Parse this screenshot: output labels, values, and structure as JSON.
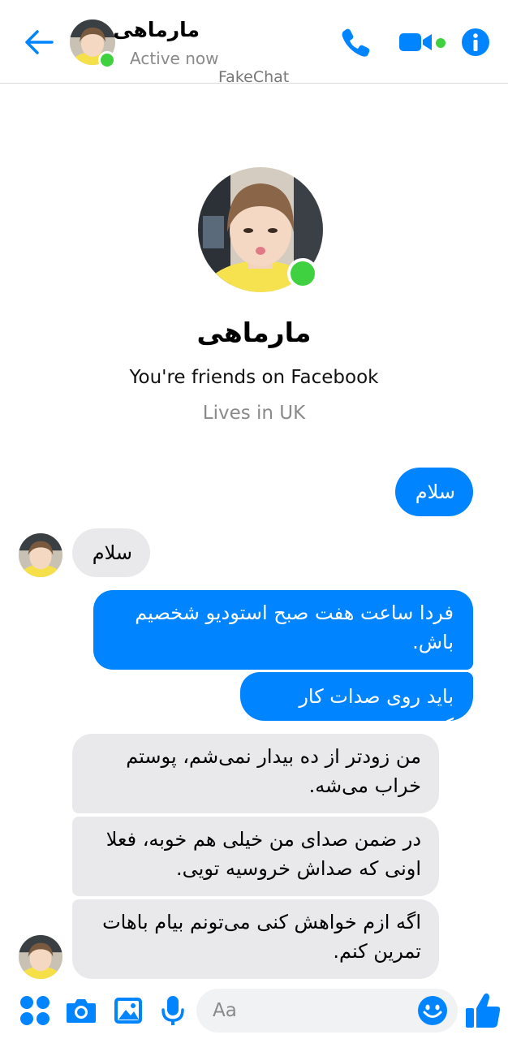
{
  "header": {
    "contact_name": "مارماهی",
    "status": "Active now",
    "watermark": "FakeChat",
    "icons": [
      "back-arrow-icon",
      "phone-icon",
      "video-camera-icon",
      "info-icon"
    ]
  },
  "profile": {
    "name": "مارماهی",
    "relationship": "You're friends on Facebook",
    "location": "Lives in UK"
  },
  "messages": [
    {
      "direction": "outgoing",
      "text": "سلام"
    },
    {
      "direction": "incoming",
      "text": "سلام"
    },
    {
      "direction": "outgoing",
      "text": "فردا ساعت هفت صبح استودیو شخصیم باش."
    },
    {
      "direction": "outgoing",
      "text": "باید روی صدات کار کنم."
    },
    {
      "direction": "incoming",
      "text": "من زودتر از ده بیدار نمی‌شم، پوستم خراب می‌شه."
    },
    {
      "direction": "incoming",
      "text": "در ضمن صدای من خیلی هم خوبه، فعلا اونی که صداش خروسیه تویی."
    },
    {
      "direction": "incoming",
      "text": "اگه ازم خواهش کنی می‌تونم بیام باهات تمرین کنم."
    }
  ],
  "composer": {
    "placeholder": "Aa",
    "icons": [
      "apps-icon",
      "camera-icon",
      "gallery-icon",
      "microphone-icon",
      "emoji-icon",
      "thumbs-up-icon"
    ]
  },
  "colors": {
    "accent": "#0084ff",
    "online": "#3fd13f",
    "incoming_bubble": "#e9e9eb"
  }
}
